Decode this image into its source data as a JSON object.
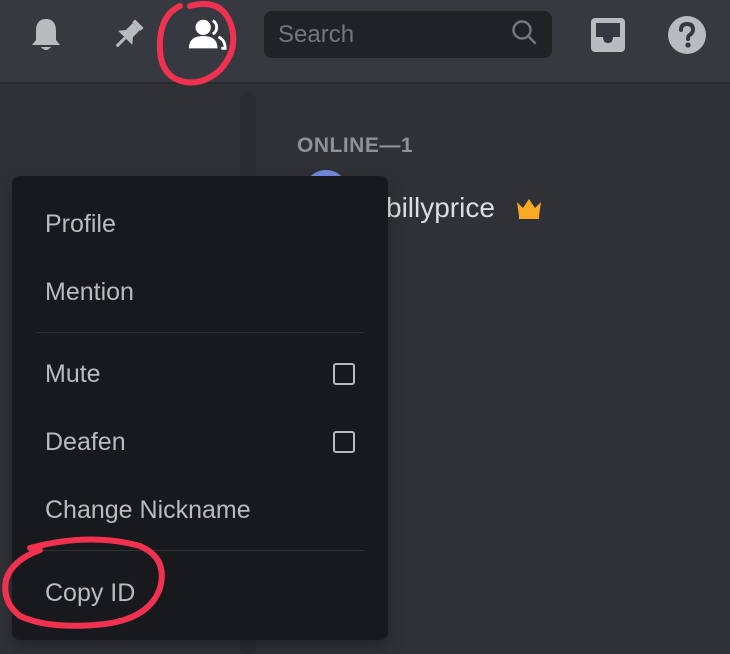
{
  "toolbar": {
    "icons": [
      "bell-icon",
      "pin-icon",
      "members-icon",
      "inbox-icon",
      "help-icon"
    ],
    "search": {
      "placeholder": "Search"
    }
  },
  "members": {
    "section_header": "ONLINE—1",
    "list": [
      {
        "name": "billyprice",
        "badge": "crown-icon"
      }
    ]
  },
  "context_menu": {
    "items": [
      {
        "label": "Profile"
      },
      {
        "label": "Mention"
      },
      {
        "label": "Mute",
        "checked": false
      },
      {
        "label": "Deafen",
        "checked": false
      },
      {
        "label": "Change Nickname"
      },
      {
        "label": "Copy ID"
      }
    ]
  },
  "colors": {
    "background": "#36393f",
    "sidebar": "#2f3136",
    "menu": "#18191c",
    "annotation": "#f0314f",
    "crown": "#f9a825"
  }
}
